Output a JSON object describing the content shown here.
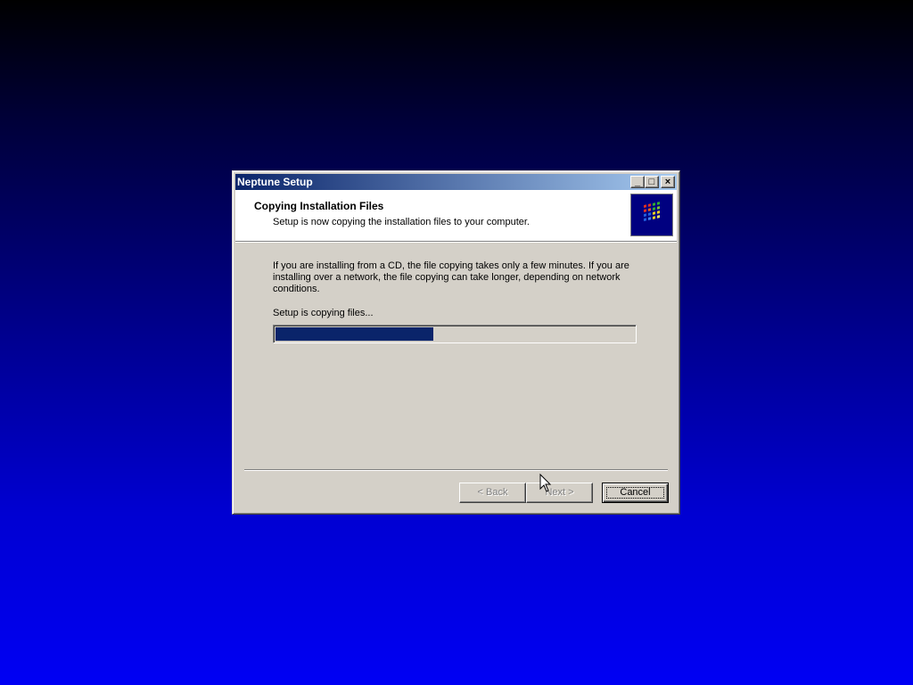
{
  "window": {
    "title": "Neptune Setup",
    "controls": {
      "minimize": "_",
      "maximize": "□",
      "close": "×"
    }
  },
  "header": {
    "title": "Copying Installation Files",
    "subtitle": "Setup is now copying the installation files to your computer.",
    "logo_icon": "windows-logo-icon"
  },
  "body": {
    "description": "If you are installing from a CD, the file copying takes only a few minutes.  If you are installing over a network, the file copying can take longer, depending on network conditions.",
    "status": "Setup is copying files...",
    "progress": 0.44
  },
  "buttons": {
    "back": "< Back",
    "next": "Next >",
    "cancel": "Cancel"
  },
  "colors": {
    "accent": "#0a246a",
    "face": "#d4d0c8"
  }
}
